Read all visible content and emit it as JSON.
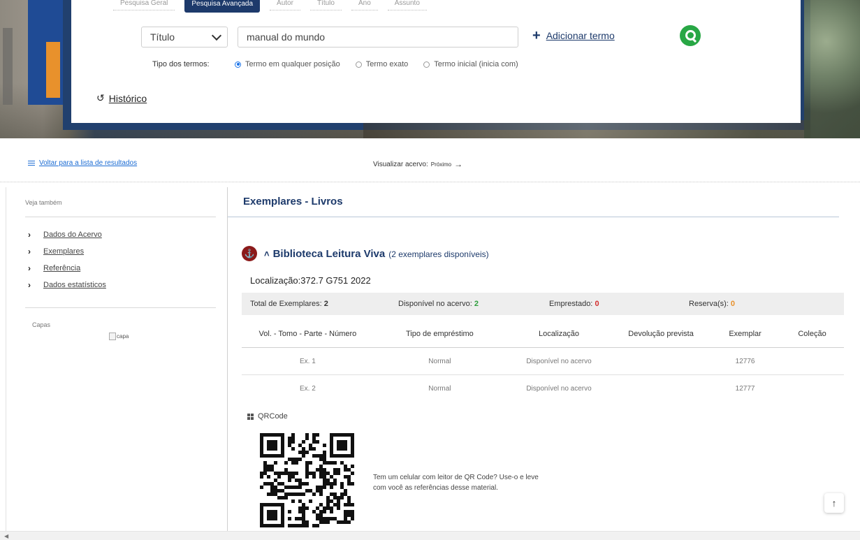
{
  "search": {
    "tabs": [
      "Pesquisa Geral",
      "Pesquisa Avançada",
      "Autor",
      "Título",
      "Ano",
      "Assunto"
    ],
    "field_select": "Título",
    "term_value": "manual do mundo",
    "add_term": "Adicionar termo",
    "term_type_label": "Tipo dos termos:",
    "term_types": [
      "Termo em qualquer posição",
      "Termo exato",
      "Termo inicial (inicia com)"
    ],
    "history": "Histórico"
  },
  "nav": {
    "back": "Voltar para a lista de resultados",
    "view_label": "Visualizar acervo:",
    "next": "Próximo"
  },
  "sidebar": {
    "see_also": "Veja também",
    "items": [
      {
        "label": "Dados do Acervo"
      },
      {
        "label": "Exemplares"
      },
      {
        "label": "Referência"
      },
      {
        "label": "Dados estatísticos"
      }
    ],
    "covers_label": "Capas",
    "cover_alt": "capa"
  },
  "main": {
    "title": "Exemplares - Livros",
    "library_name": "Biblioteca Leitura Viva",
    "library_availability": "(2 exemplares disponíveis)",
    "location": "Localização:372.7 G751 2022",
    "totals": {
      "total_label": "Total de Exemplares:",
      "total_value": "2",
      "available_label": "Disponível no acervo:",
      "available_value": "2",
      "loaned_label": "Emprestado:",
      "loaned_value": "0",
      "reserve_label": "Reserva(s):",
      "reserve_value": "0"
    },
    "table": {
      "headers": [
        "Vol. - Tomo - Parte - Número",
        "Tipo de empréstimo",
        "Localização",
        "Devolução prevista",
        "Exemplar",
        "Coleção"
      ],
      "rows": [
        [
          "Ex. 1",
          "Normal",
          "Disponível no acervo",
          "",
          "12776",
          ""
        ],
        [
          "Ex. 2",
          "Normal",
          "Disponível no acervo",
          "",
          "12777",
          ""
        ]
      ]
    },
    "qr_title": "QRCode",
    "qr_text": "Tem um celular com leitor de QR Code? Use-o e leve com você as referências desse material."
  },
  "colors": {
    "navy": "#1d3a6b",
    "link_blue": "#1a6bd3",
    "green": "#2e9e3d",
    "orange": "#e8912c",
    "red": "#d32f2f"
  },
  "icons": [
    "search-icon",
    "plus-icon",
    "history-icon",
    "list-icon",
    "arrow-right-icon",
    "chevron-right-icon",
    "library-icon",
    "qrcode-icon",
    "arrow-up-icon"
  ]
}
